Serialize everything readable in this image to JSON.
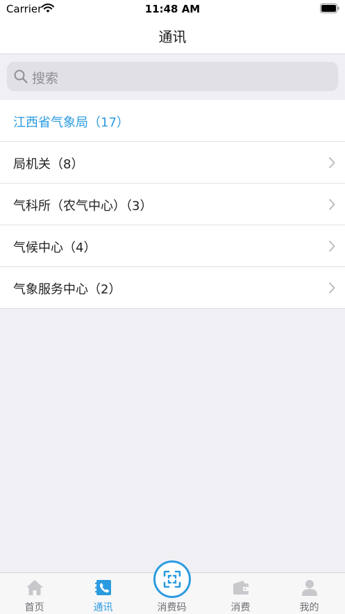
{
  "status_bar": {
    "carrier": "Carrier",
    "time": "11:48 AM"
  },
  "nav": {
    "title": "通讯"
  },
  "search": {
    "placeholder": "搜索"
  },
  "list": {
    "header": "江西省气象局（17）",
    "items": [
      {
        "label": "局机关（8）"
      },
      {
        "label": "气科所（农气中心）（3）"
      },
      {
        "label": "气候中心（4）"
      },
      {
        "label": "气象服务中心（2）"
      }
    ]
  },
  "tabs": [
    {
      "label": "首页",
      "icon": "home-icon",
      "active": false
    },
    {
      "label": "通讯",
      "icon": "contacts-icon",
      "active": true
    },
    {
      "label": "消费码",
      "icon": "scan-code-icon",
      "active": false
    },
    {
      "label": "消费",
      "icon": "wallet-icon",
      "active": false
    },
    {
      "label": "我的",
      "icon": "profile-icon",
      "active": false
    }
  ],
  "colors": {
    "accent": "#2b9be0",
    "background": "#efeff4",
    "inactive_tab": "#c8c8cc"
  }
}
